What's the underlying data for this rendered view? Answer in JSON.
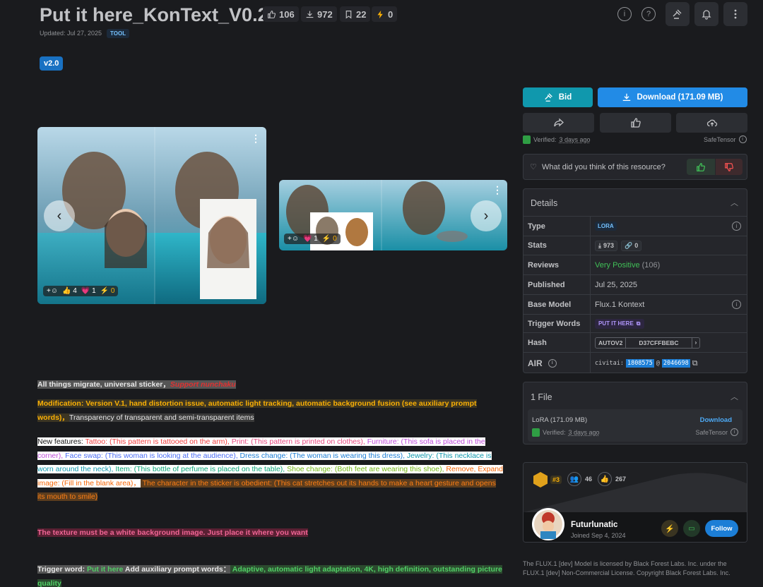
{
  "header": {
    "title": "Put it here_KonText_V0.2",
    "stats": {
      "likes": "106",
      "downloads": "972",
      "bookmarks": "22",
      "buzz": "0"
    },
    "updated": "Updated: Jul 27, 2025",
    "type_badge": "TOOL",
    "version_badge": "v2.0"
  },
  "gallery": {
    "left_card": {
      "reactions": {
        "thumbs": "4",
        "hearts": "1",
        "buzz": "0"
      }
    },
    "right_card": {
      "reactions": {
        "hearts": "1",
        "buzz": "0"
      }
    }
  },
  "description": {
    "line1_label": "All things migrate, universal sticker，",
    "line1_highlight": "Support nunchaku",
    "line2_part1": "Modification: Version V.1, hand distortion issue, automatic light tracking, automatic background fusion (see auxiliary prompt words)，",
    "line2_part2": "Transparency of transparent and semi-transparent items",
    "features_label": "New features:",
    "f_tattoo": " Tattoo: (This pattern is tattooed on the arm),",
    "f_print": " Print: (This pattern is printed on clothes),",
    "f_furniture": " Furniture: (This sofa is placed in the corner),",
    "f_faceswap": " Face swap: (This woman is looking at the audience),",
    "f_dress": " Dress change: (The woman is wearing this dress),",
    "f_jewelry": " Jewelry: (This necklace is worn around the neck),",
    "f_item": " Item: (This bottle of perfume is placed on the table),",
    "f_shoe": " Shoe change: (Both feet are wearing this shoe),",
    "f_remove": " Remove, Expand image: (Fill in the blank area)，",
    "f_sticker": " The character in the sticker is obedient: (This cat stretches out its hands to make a heart gesture and opens its mouth to smile)",
    "texture_note": "The texture must be a white background image. Just place it where you want",
    "trigger_label": "Trigger word:",
    "trigger_value": " Put it here ",
    "aux_label": "Add auxiliary prompt words：",
    "aux_value": " Adaptive, automatic light adaptation, 4K, high definition, outstanding picture quality"
  },
  "actions": {
    "bid_label": "Bid",
    "download_label": "Download (171.09 MB)",
    "verified_text": "Verified: ",
    "verified_when": "3 days ago",
    "safetensor": "SafeTensor",
    "feedback_question": "What did you think of this resource?"
  },
  "details": {
    "heading": "Details",
    "rows": {
      "type_key": "Type",
      "type_val": "LORA",
      "stats_key": "Stats",
      "stats_downloads": "973",
      "stats_links": "0",
      "reviews_key": "Reviews",
      "reviews_val": "Very Positive",
      "reviews_count": "(106)",
      "published_key": "Published",
      "published_val": "Jul 25, 2025",
      "base_key": "Base Model",
      "base_val": "Flux.1 Kontext",
      "trigger_key": "Trigger Words",
      "trigger_val": "PUT IT HERE",
      "hash_key": "Hash",
      "hash_type": "AUTOV2",
      "hash_val": "D37CFFBEBC",
      "air_key": "AIR",
      "air_prefix": "civitai:",
      "air_model": "1808575",
      "air_at": "@",
      "air_version": "2046698"
    }
  },
  "files": {
    "heading": "1 File",
    "file_name": "LoRA (171.09 MB)",
    "download_link": "Download",
    "verified_text": "Verified: ",
    "verified_when": "3 days ago",
    "safetensor": "SafeTensor"
  },
  "creator": {
    "rank": "#3",
    "followers": "46",
    "likes": "267",
    "name": "Futurlunatic",
    "joined": "Joined Sep 4, 2024",
    "follow_label": "Follow"
  },
  "footer": {
    "license": "The FLUX.1 [dev] Model is licensed by Black Forest Labs. Inc. under the FLUX.1 [dev] Non-Commercial License. Copyright Black Forest Labs. Inc."
  },
  "colors": {
    "bid": "#1098ad",
    "download": "#228be6",
    "follow": "#1c7ed6",
    "positive": "#40c057"
  }
}
